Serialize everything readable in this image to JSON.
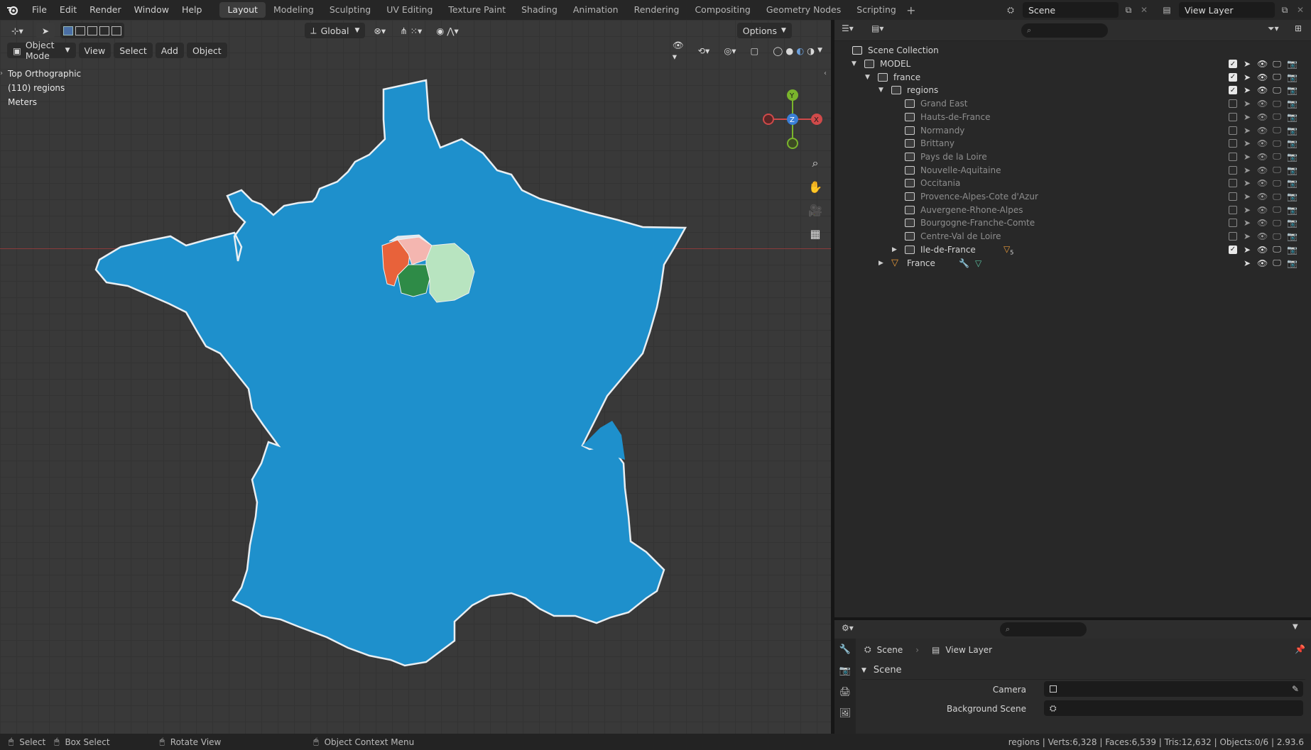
{
  "menu": {
    "logo_icon": "blender-logo-icon",
    "items": [
      "File",
      "Edit",
      "Render",
      "Window",
      "Help"
    ]
  },
  "workspaces": {
    "active": "Layout",
    "tabs": [
      "Layout",
      "Modeling",
      "Sculpting",
      "UV Editing",
      "Texture Paint",
      "Shading",
      "Animation",
      "Rendering",
      "Compositing",
      "Geometry Nodes",
      "Scripting"
    ]
  },
  "top_right": {
    "scene_name": "Scene",
    "view_layer": "View Layer"
  },
  "viewport": {
    "transform_orientation": "Global",
    "options_label": "Options",
    "mode": "Object Mode",
    "header_menus": [
      "View",
      "Select",
      "Add",
      "Object"
    ],
    "overlay": {
      "view_name": "Top Orthographic",
      "collection_info": "(110) regions",
      "units": "Meters"
    },
    "gizmo_axes": [
      "Y",
      "Z",
      "X"
    ],
    "colors": {
      "background": "#393939",
      "map_fill": "#1e90cc",
      "map_outline": "#e8eef2",
      "idf_region_1": "#e8623a",
      "idf_region_2": "#f4b6b0",
      "idf_region_3": "#2e8b47",
      "idf_region_4": "#b8e4c0",
      "x_axis_line": "#8a3a3a"
    }
  },
  "outliner": {
    "root": "Scene Collection",
    "items": [
      {
        "label": "MODEL",
        "checked": true
      },
      {
        "label": "france",
        "checked": true
      },
      {
        "label": "regions",
        "checked": true
      },
      {
        "label": "Grand East",
        "checked": false
      },
      {
        "label": "Hauts-de-France",
        "checked": false
      },
      {
        "label": "Normandy",
        "checked": false
      },
      {
        "label": "Brittany",
        "checked": false
      },
      {
        "label": "Pays de la Loire",
        "checked": false
      },
      {
        "label": "Nouvelle-Aquitaine",
        "checked": false
      },
      {
        "label": "Occitania",
        "checked": false
      },
      {
        "label": "Provence-Alpes-Cote d'Azur",
        "checked": false
      },
      {
        "label": "Auvergene-Rhone-Alpes",
        "checked": false
      },
      {
        "label": "Bourgogne-Franche-Comte",
        "checked": false
      },
      {
        "label": "Centre-Val de Loire",
        "checked": false
      },
      {
        "label": "Ile-de-France",
        "checked": true
      },
      {
        "label": "France",
        "checked": null
      }
    ],
    "ile_de_france_badge": "5"
  },
  "properties": {
    "breadcrumb_scene": "Scene",
    "breadcrumb_view_layer": "View Layer",
    "panel_title": "Scene",
    "fields": [
      {
        "label": "Camera",
        "value": ""
      },
      {
        "label": "Background Scene",
        "value": ""
      }
    ]
  },
  "statusbar": {
    "select": "Select",
    "box_select": "Box Select",
    "rotate_view": "Rotate View",
    "context_menu": "Object Context Menu",
    "stats": "regions | Verts:6,328 | Faces:6,539 | Tris:12,632 | Objects:0/6 | 2.93.6"
  }
}
